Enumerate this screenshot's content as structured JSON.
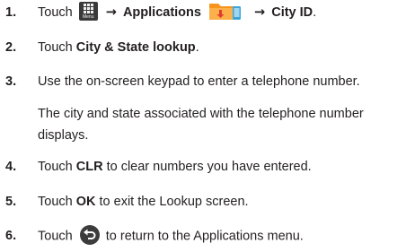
{
  "steps": [
    {
      "num": "1.",
      "touch": "Touch",
      "menu_caption": "Menu",
      "apps": "Applications",
      "city_id": "City ID",
      "end": "."
    },
    {
      "num": "2.",
      "touch": "Touch",
      "target": "City & State lookup",
      "end": "."
    },
    {
      "num": "3.",
      "text": "Use the on-screen keypad to enter a telephone number.",
      "note_line1": "The city and state associated with the telephone number",
      "note_line2": "displays."
    },
    {
      "num": "4.",
      "touch": "Touch",
      "target": "CLR",
      "rest": " to clear numbers you have entered."
    },
    {
      "num": "5.",
      "touch": "Touch",
      "target": "OK",
      "rest": " to exit the Lookup screen."
    },
    {
      "num": "6.",
      "touch": "Touch",
      "rest": " to return to the Applications menu."
    }
  ],
  "icons": {
    "arrow": "→",
    "menu": "menu-grid-icon",
    "applications": "applications-folder-icon",
    "back": "back-arrow-icon"
  },
  "colors": {
    "text": "#231f20",
    "folder_orange": "#f7941d",
    "folder_blue": "#3ba5d8",
    "icon_dark": "#3a3a3a"
  }
}
